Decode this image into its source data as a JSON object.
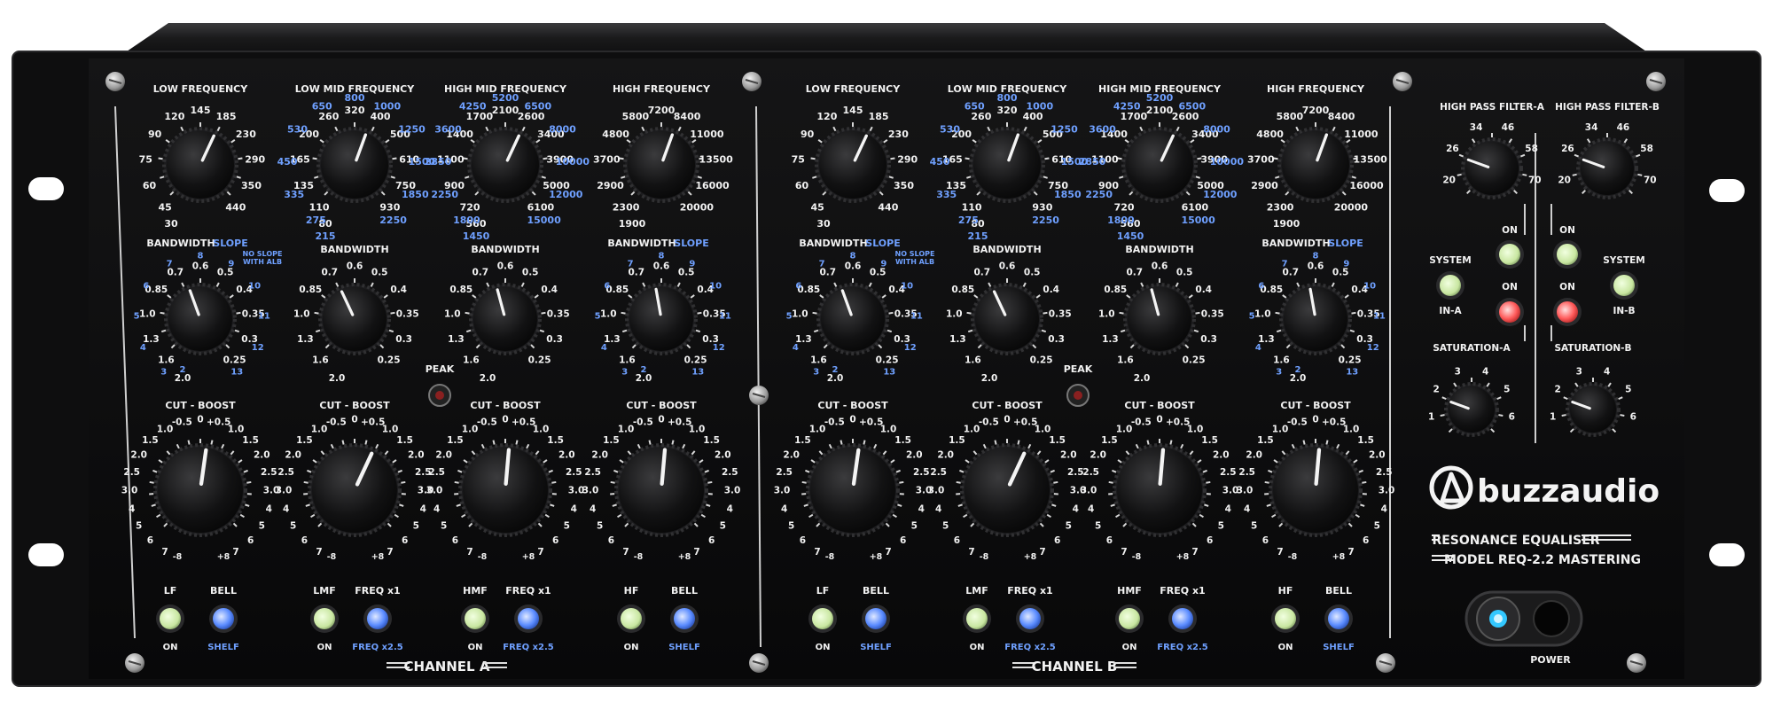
{
  "channels": [
    {
      "name": "CHANNEL A",
      "peak_label": "PEAK"
    },
    {
      "name": "CHANNEL B",
      "peak_label": "PEAK"
    }
  ],
  "bands": [
    {
      "key": "lf",
      "title": "LOW FREQUENCY",
      "freq_white": [
        "45",
        "60",
        "75",
        "90",
        "120",
        "145",
        "185",
        "230",
        "290",
        "350",
        "440",
        "30"
      ],
      "freq_blue": [],
      "bw_slope": true,
      "bw_white": [
        "1.6",
        "1.3",
        "1.0",
        "0.85",
        "0.7",
        "0.6",
        "0.5",
        "0.4",
        "0.35",
        "0.3",
        "0.25",
        "2.0"
      ],
      "bw_blue": [
        "3",
        "4",
        "5",
        "6",
        "7",
        "8",
        "9",
        "10",
        "11",
        "12",
        "13",
        "2"
      ],
      "switch_left": "LF",
      "switch_left_sub": "ON",
      "switch_right": "BELL",
      "switch_right_sub": "SHELF"
    },
    {
      "key": "lmf",
      "title": "LOW MID FREQUENCY",
      "freq_white": [
        "110",
        "135",
        "165",
        "200",
        "260",
        "320",
        "400",
        "500",
        "610",
        "750",
        "930",
        "80"
      ],
      "freq_blue": [
        "275",
        "335",
        "450",
        "530",
        "650",
        "800",
        "1000",
        "1250",
        "1500",
        "1850",
        "2250",
        "215"
      ],
      "bw_slope": false,
      "bw_white": [
        "1.6",
        "1.3",
        "1.0",
        "0.85",
        "0.7",
        "0.6",
        "0.5",
        "0.4",
        "0.35",
        "0.3",
        "0.25",
        "2.0"
      ],
      "bw_blue": [],
      "switch_left": "LMF",
      "switch_left_sub": "ON",
      "switch_right": "FREQ x1",
      "switch_right_sub": "FREQ x2.5"
    },
    {
      "key": "hmf",
      "title": "HIGH MID FREQUENCY",
      "freq_white": [
        "720",
        "900",
        "1100",
        "1400",
        "1700",
        "2100",
        "2600",
        "3400",
        "3900",
        "5000",
        "6100",
        "560"
      ],
      "freq_blue": [
        "1800",
        "2250",
        "2850",
        "3600",
        "4250",
        "5200",
        "6500",
        "8000",
        "10000",
        "12000",
        "15000",
        "1450"
      ],
      "bw_slope": false,
      "bw_white": [
        "1.6",
        "1.3",
        "1.0",
        "0.85",
        "0.7",
        "0.6",
        "0.5",
        "0.4",
        "0.35",
        "0.3",
        "0.25",
        "2.0"
      ],
      "bw_blue": [],
      "switch_left": "HMF",
      "switch_left_sub": "ON",
      "switch_right": "FREQ x1",
      "switch_right_sub": "FREQ x2.5"
    },
    {
      "key": "hf",
      "title": "HIGH FREQUENCY",
      "freq_white": [
        "2300",
        "2900",
        "3700",
        "4800",
        "5800",
        "7200",
        "8400",
        "11000",
        "13500",
        "16000",
        "20000",
        "1900"
      ],
      "freq_blue": [],
      "bw_slope": true,
      "bw_white": [
        "1.6",
        "1.3",
        "1.0",
        "0.85",
        "0.7",
        "0.6",
        "0.5",
        "0.4",
        "0.35",
        "0.3",
        "0.25",
        "2.0"
      ],
      "bw_blue": [
        "3",
        "4",
        "5",
        "6",
        "7",
        "8",
        "9",
        "10",
        "11",
        "12",
        "13",
        "2"
      ],
      "switch_left": "HF",
      "switch_left_sub": "ON",
      "switch_right": "BELL",
      "switch_right_sub": "SHELF"
    }
  ],
  "labels": {
    "bandwidth": "BANDWIDTH",
    "slope": "SLOPE",
    "no_slope_1": "NO SLOPE",
    "no_slope_2": "WITH ALB",
    "cut_boost": "CUT - BOOST",
    "cb_marks": [
      "7",
      "6",
      "5",
      "4",
      "3.0",
      "2.5",
      "2.0",
      "1.5",
      "1.0",
      "-0.5",
      "0",
      "+0.5",
      "1.0",
      "1.5",
      "2.0",
      "2.5",
      "3.0",
      "4",
      "5",
      "6",
      "7"
    ],
    "cb_bottom": [
      "-8",
      "+8"
    ]
  },
  "right_panel": {
    "hpf_a": "HIGH PASS FILTER-A",
    "hpf_b": "HIGH PASS FILTER-B",
    "hpf_marks": [
      "20",
      "26",
      "34",
      "46",
      "58",
      "70"
    ],
    "on": "ON",
    "system": "SYSTEM",
    "in_a": "IN-A",
    "in_b": "IN-B",
    "sat_a": "SATURATION-A",
    "sat_b": "SATURATION-B",
    "sat_marks": [
      "1",
      "2",
      "3",
      "4",
      "5",
      "6"
    ],
    "brand": "buzzaudio",
    "model_1": "RESONANCE EQUALISER",
    "model_2": "MODEL REQ-2.2 MASTERING",
    "power": "POWER"
  },
  "colors": {
    "panel": "#0c0c0d",
    "text": "#f2f2f2",
    "blue_text": "#6fa0ff",
    "led_green": "#c8e6a0",
    "led_blue": "#5b8cff",
    "led_red": "#ff5a5a",
    "power_led": "#33c8ff"
  }
}
